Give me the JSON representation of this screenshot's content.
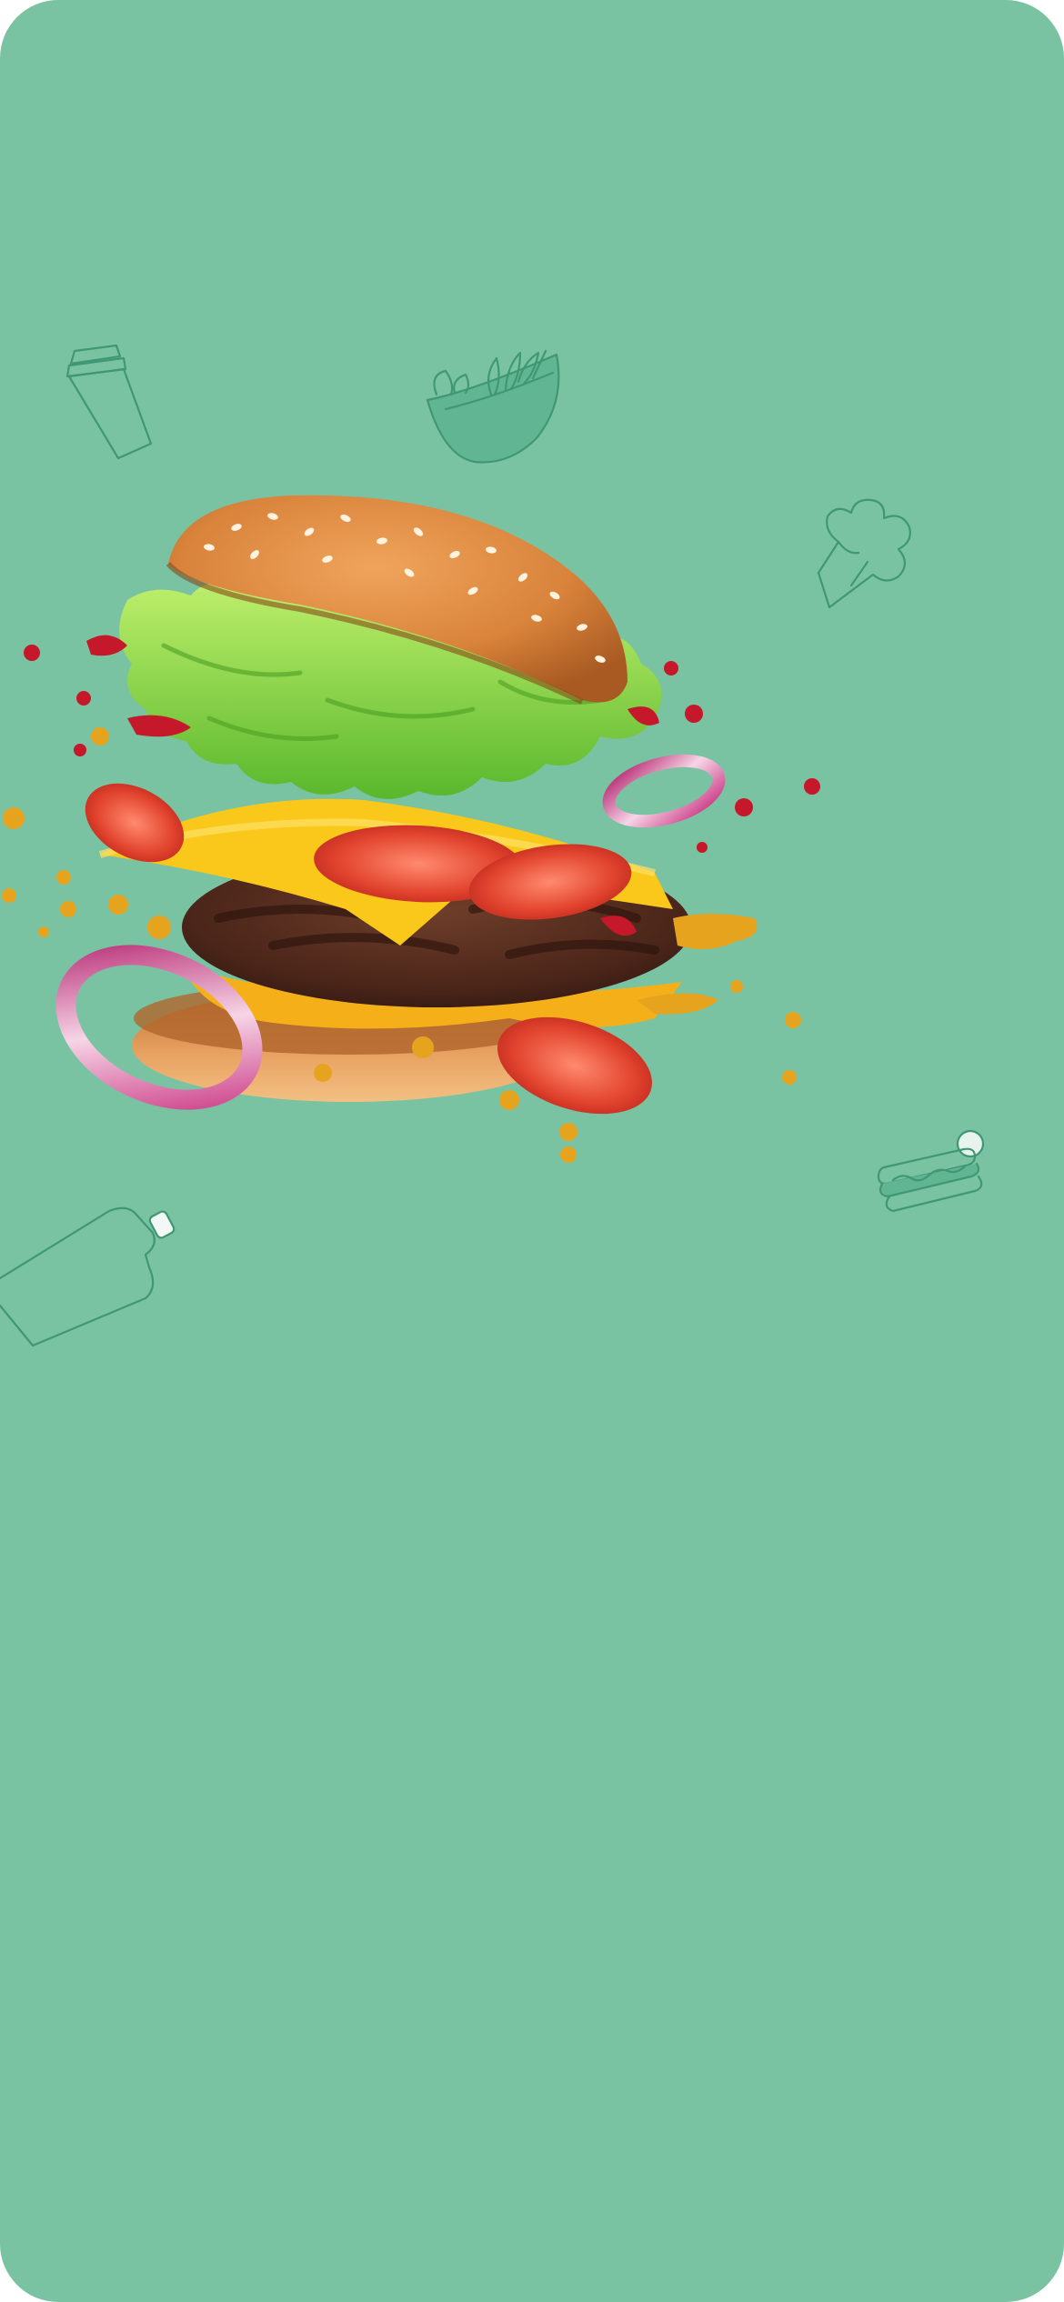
{
  "screen": {
    "background_color": "#79c3a3",
    "doodle_stroke_color": "#3f9774"
  },
  "decorations": [
    {
      "icon": "coffee-cup-icon"
    },
    {
      "icon": "salad-bowl-icon"
    },
    {
      "icon": "broccoli-icon"
    },
    {
      "icon": "hot-dog-icon"
    },
    {
      "icon": "bottle-icon"
    }
  ],
  "hero": {
    "icon": "burger-illustration"
  }
}
